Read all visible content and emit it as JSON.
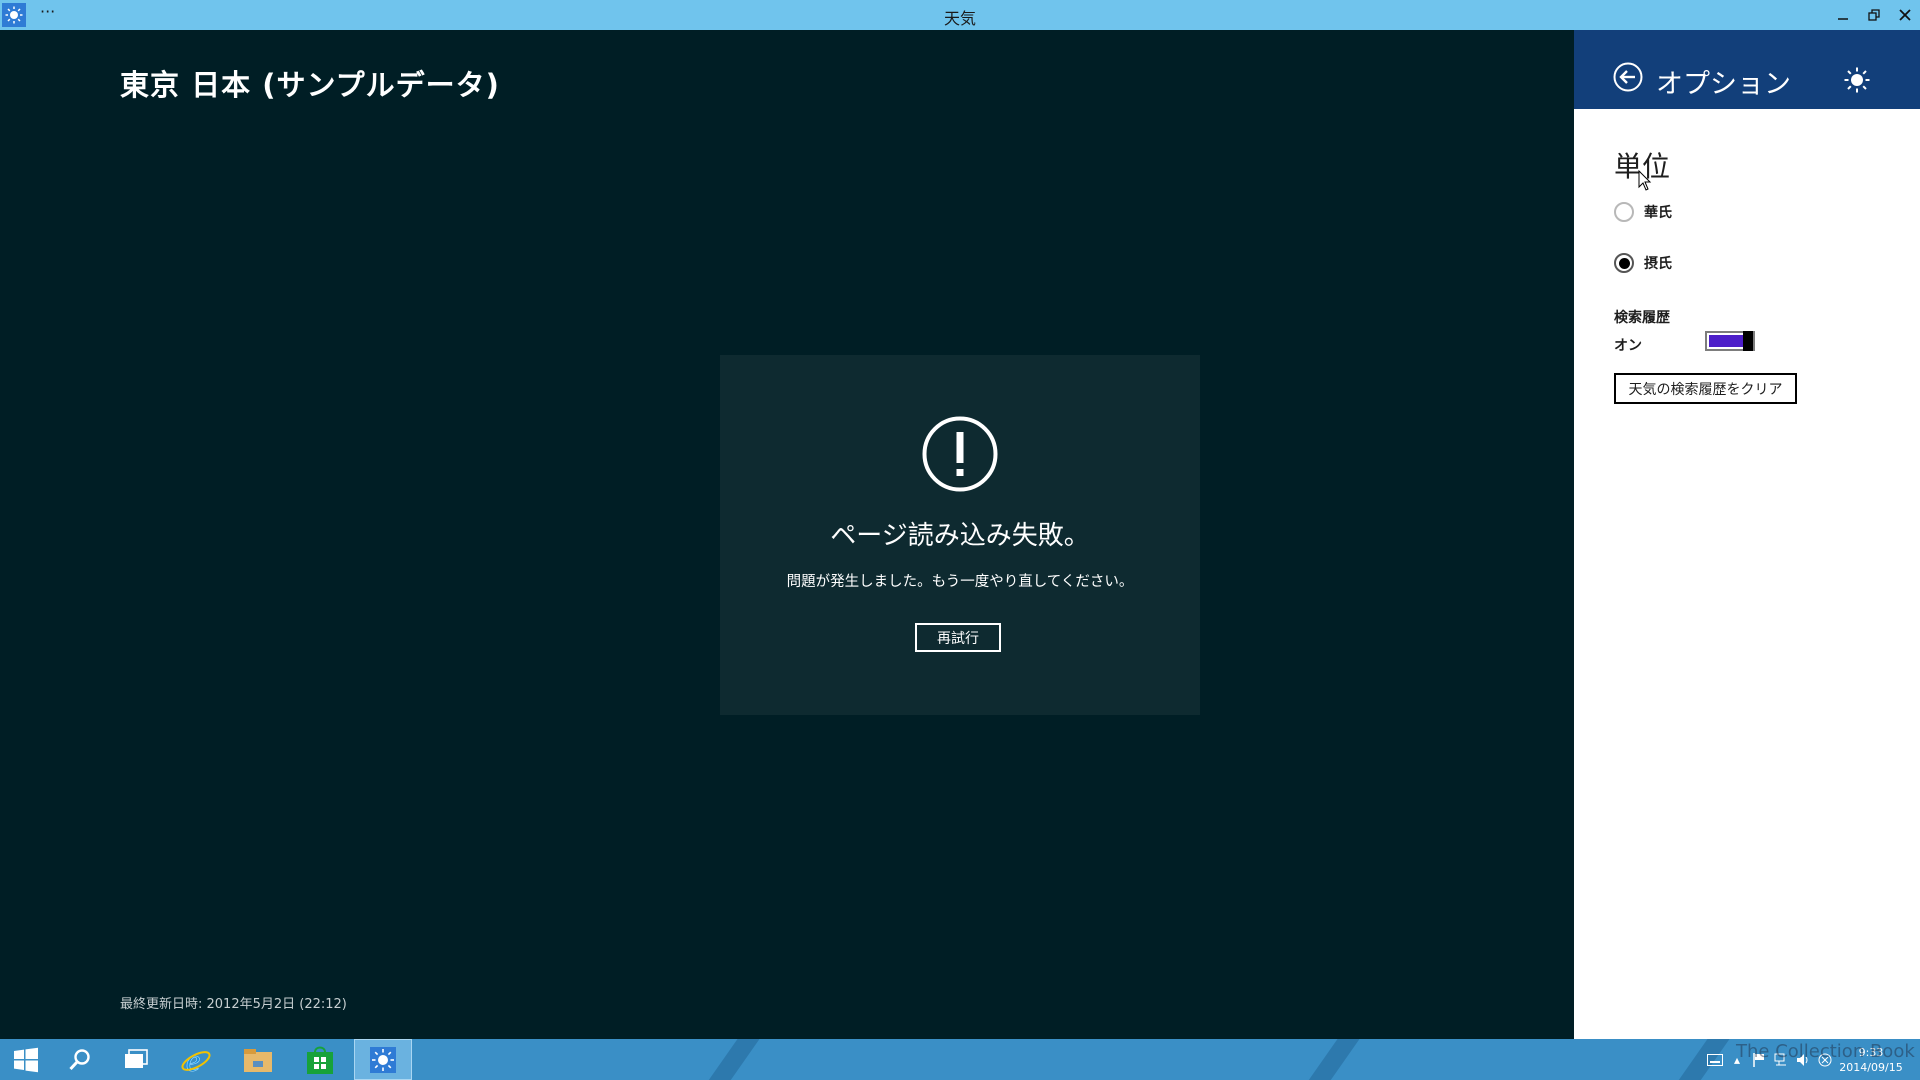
{
  "window": {
    "title": "天気",
    "menu_glyph": "···"
  },
  "main": {
    "location_title": "東京 日本 (サンプルデータ)",
    "error": {
      "title": "ページ読み込み失敗。",
      "message": "問題が発生しました。もう一度やり直してください。",
      "retry_label": "再試行"
    },
    "last_updated": "最終更新日時: 2012年5月2日 (22:12)"
  },
  "options": {
    "title": "オプション",
    "units_heading": "単位",
    "units": [
      {
        "label": "華氏",
        "selected": false
      },
      {
        "label": "摂氏",
        "selected": true
      }
    ],
    "search_history_label": "検索履歴",
    "search_history_state": "オン",
    "search_history_on": true,
    "clear_history_label": "天気の検索履歴をクリア"
  },
  "taskbar": {
    "items": [
      "start-icon",
      "search-icon",
      "task-view-icon",
      "internet-explorer-icon",
      "file-explorer-icon",
      "store-icon",
      "weather-icon"
    ],
    "clock_time": "9:33",
    "clock_date": "2014/09/15",
    "watermark": "The Collection Book"
  },
  "colors": {
    "titlebar": "#70c4ed",
    "app_background": "#001e25",
    "error_panel": "#0e2a30",
    "options_header": "#123f7a",
    "toggle_fill": "#4d1ec9",
    "taskbar": "#3a8fc6"
  }
}
